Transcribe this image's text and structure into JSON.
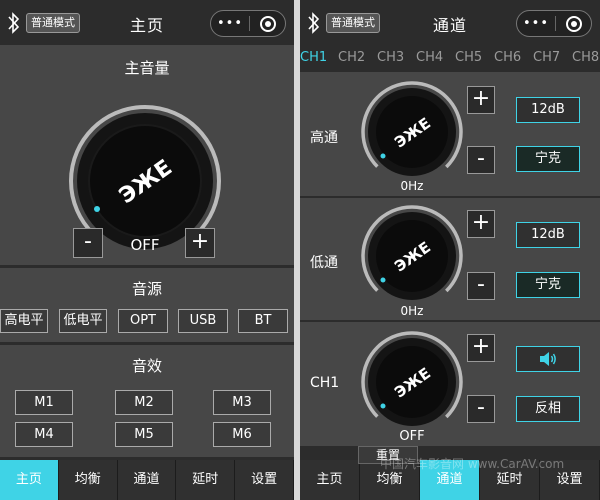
{
  "left": {
    "mode_label": "普通模式",
    "title": "主页",
    "capsule_dots": "•••",
    "master": {
      "title": "主音量",
      "value": "OFF",
      "minus": "-",
      "plus": "+"
    },
    "source": {
      "title": "音源",
      "buttons": [
        "高电平",
        "低电平",
        "OPT",
        "USB",
        "BT"
      ]
    },
    "effect": {
      "title": "音效",
      "buttons": [
        "M1",
        "M2",
        "M3",
        "M4",
        "M5",
        "M6"
      ]
    },
    "nav": [
      "主页",
      "均衡",
      "通道",
      "延时",
      "设置"
    ],
    "nav_active": 0
  },
  "right": {
    "mode_label": "普通模式",
    "title": "通道",
    "capsule_dots": "•••",
    "channels": [
      "CH1",
      "CH2",
      "CH3",
      "CH4",
      "CH5",
      "CH6",
      "CH7",
      "CH8"
    ],
    "active_channel": 0,
    "highpass": {
      "label": "高通",
      "value": "0Hz",
      "slope": "12dB",
      "type": "宁克",
      "plus": "+",
      "minus": "-"
    },
    "lowpass": {
      "label": "低通",
      "value": "0Hz",
      "slope": "12dB",
      "type": "宁克",
      "plus": "+",
      "minus": "-"
    },
    "volume": {
      "label": "CH1",
      "value": "OFF",
      "mute_icon": "speaker-icon",
      "phase": "反相",
      "plus": "+",
      "minus": "-"
    },
    "nav": [
      "主页",
      "均衡",
      "通道",
      "延时",
      "设置"
    ],
    "nav_active": 2,
    "reset_label": "重置"
  },
  "watermark": "中国汽车影音网 www.CarAV.com",
  "logo_text": "ЭЖЕ",
  "colors": {
    "accent": "#3fd3e6",
    "panel": "#474747",
    "background": "#2c2c2c"
  }
}
